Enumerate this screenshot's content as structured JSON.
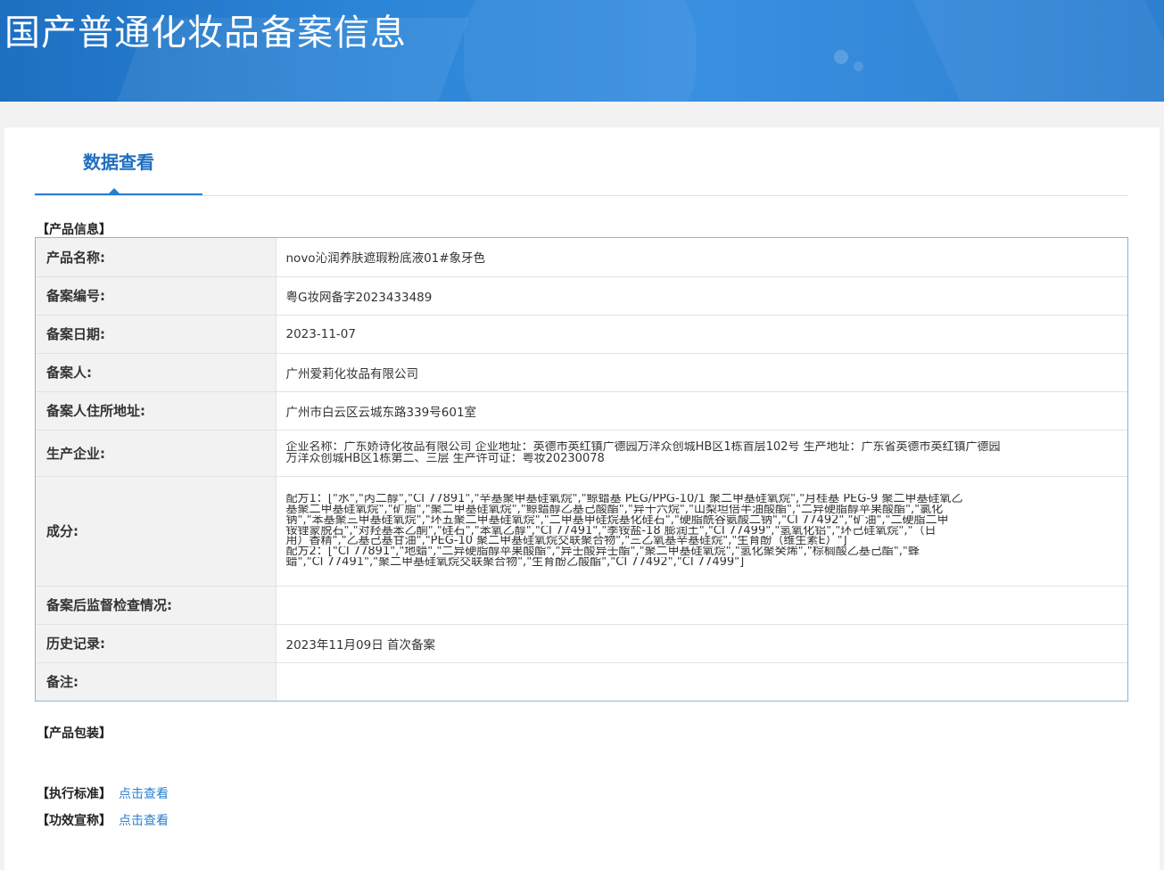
{
  "banner": {
    "title": "国产普通化妆品备案信息"
  },
  "tab": {
    "label": "数据查看"
  },
  "sections": {
    "product_info": "【产品信息】",
    "packaging": "【产品包装】"
  },
  "rows": [
    {
      "label": "产品名称:",
      "value": "novo沁润养肤遮瑕粉底液01#象牙色"
    },
    {
      "label": "备案编号:",
      "value": "粤G妆网备字2023433489"
    },
    {
      "label": "备案日期:",
      "value": "2023-11-07"
    },
    {
      "label": "备案人:",
      "value": "广州爱莉化妆品有限公司"
    },
    {
      "label": "备案人住所地址:",
      "value": "广州市白云区云城东路339号601室"
    },
    {
      "label": "生产企业:",
      "lines": [
        "企业名称：广东娇诗化妆品有限公司 企业地址：英德市英红镇广德园万洋众创城HB区1栋首层102号 生产地址：广东省英德市英红镇广德园",
        "万洋众创城HB区1栋第二、三层 生产许可证：粤妆20230078"
      ]
    },
    {
      "label": "成分:",
      "lines": [
        "配方1：[\"水\",\"丙二醇\",\"CI 77891\",\"辛基聚甲基硅氧烷\",\"鲸蜡基 PEG/PPG-10/1 聚二甲基硅氧烷\",\"月桂基 PEG-9 聚二甲基硅氧乙",
        "基聚二甲基硅氧烷\",\"矿脂\",\"聚二甲基硅氧烷\",\"鲸蜡醇乙基己酸酯\",\"异十六烷\",\"山梨坦倍半油酸酯\",\"二异硬脂醇苹果酸酯\",\"氯化",
        "钠\",\"苯基聚三甲基硅氧烷\",\"环五聚二甲基硅氧烷\",\"二甲基甲硅烷基化硅石\",\"硬脂酰谷氨酸二钠\",\"CI 77492\",\"矿油\",\"二硬脂二甲",
        "铵锂蒙脱石\",\"对羟基苯乙酮\",\"硅石\",\"苯氧乙醇\",\"CI 77491\",\"季铵盐-18 膨润土\",\"CI 77499\",\"氢氧化铝\",\"环己硅氧烷\",\"（日",
        "用）香精\",\"乙基己基甘油\",\"PEG-10 聚二甲基硅氧烷交联聚合物\",\"三乙氧基辛基硅烷\",\"生育酚（维生素E）\"]",
        "配方2：[\"CI 77891\",\"地蜡\",\"二异硬脂醇苹果酸酯\",\"异壬酸异壬酯\",\"聚二甲基硅氧烷\",\"氢化聚癸烯\",\"棕榈酸乙基己酯\",\"蜂",
        "蜡\",\"CI 77491\",\"聚二甲基硅氧烷交联聚合物\",\"生育酚乙酸酯\",\"CI 77492\",\"CI 77499\"]"
      ]
    },
    {
      "label": "备案后监督检查情况:",
      "value": ""
    },
    {
      "label": "历史记录:",
      "value": "2023年11月09日 首次备案"
    },
    {
      "label": "备注:",
      "value": ""
    }
  ],
  "links": [
    {
      "label": "【执行标准】",
      "link": "点击查看"
    },
    {
      "label": "【功效宣称】",
      "link": "点击查看"
    }
  ]
}
